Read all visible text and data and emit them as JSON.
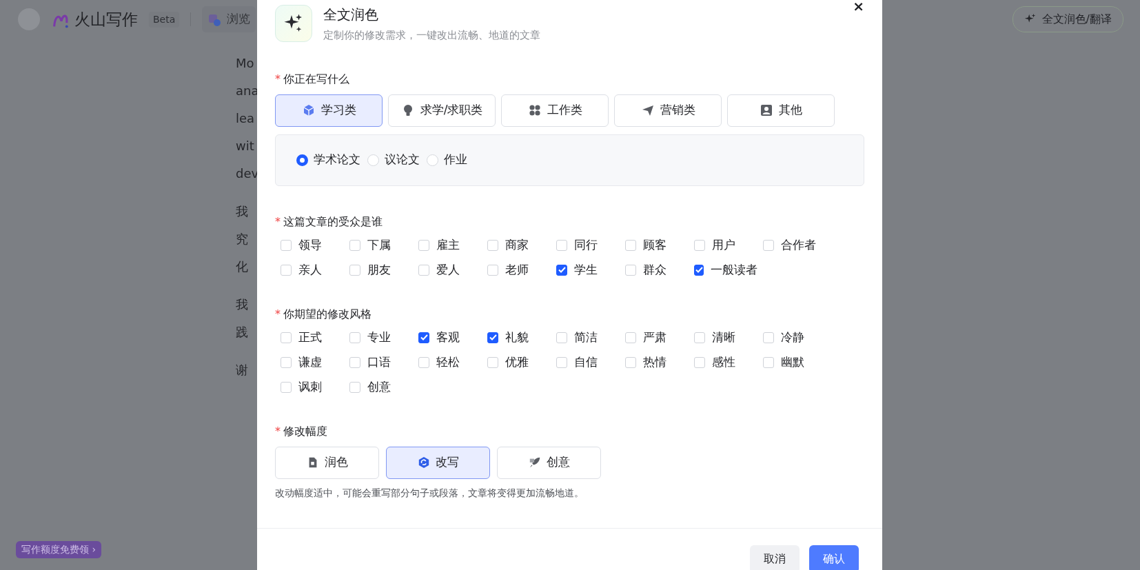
{
  "app": {
    "brand": "火山写作",
    "badge": "Beta",
    "tab_partial": "浏览",
    "action": "全文润色/翻译",
    "promo": "写作额度免费领",
    "promo_arrow": "›"
  },
  "article": {
    "paragraphs": [
      [
        {
          "start": "Mo"
        },
        {
          "start": "ana"
        },
        {
          "start": "lea"
        },
        {
          "start": "wit"
        },
        {
          "start": "dev"
        }
      ],
      [
        {
          "start": "我"
        },
        {
          "start": "究"
        },
        {
          "start": "化"
        }
      ],
      [
        {
          "start": "我"
        },
        {
          "start": "践"
        }
      ],
      [
        {
          "start": "谢"
        }
      ]
    ]
  },
  "dialog": {
    "title": "全文润色",
    "subtitle": "定制你的修改需求，一键改出流畅、地道的文章",
    "close": "×",
    "sections": [
      {
        "kind": "categories",
        "marker": "*",
        "label": "你正在写什么",
        "options": [
          {
            "label": "学习类",
            "selected": true
          },
          {
            "label": "求学/求职类",
            "selected": false
          },
          {
            "label": "工作类",
            "selected": false
          },
          {
            "label": "营销类",
            "selected": false
          },
          {
            "label": "其他",
            "selected": false
          }
        ],
        "sub_options": [
          {
            "label": "学术论文",
            "selected": true
          },
          {
            "label": "议论文",
            "selected": false
          },
          {
            "label": "作业",
            "selected": false
          }
        ]
      },
      {
        "kind": "checkboxes",
        "marker": "*",
        "label": "这篇文章的受众是谁",
        "options": [
          {
            "label": "领导",
            "checked": false
          },
          {
            "label": "下属",
            "checked": false
          },
          {
            "label": "雇主",
            "checked": false
          },
          {
            "label": "商家",
            "checked": false
          },
          {
            "label": "同行",
            "checked": false
          },
          {
            "label": "顾客",
            "checked": false
          },
          {
            "label": "用户",
            "checked": false
          },
          {
            "label": "合作者",
            "checked": false
          },
          {
            "label": "亲人",
            "checked": false
          },
          {
            "label": "朋友",
            "checked": false
          },
          {
            "label": "爱人",
            "checked": false
          },
          {
            "label": "老师",
            "checked": false
          },
          {
            "label": "学生",
            "checked": true
          },
          {
            "label": "群众",
            "checked": false
          },
          {
            "label": "一般读者",
            "checked": true
          }
        ]
      },
      {
        "kind": "checkboxes",
        "marker": "*",
        "label": "你期望的修改风格",
        "options": [
          {
            "label": "正式",
            "checked": false
          },
          {
            "label": "专业",
            "checked": false
          },
          {
            "label": "客观",
            "checked": true
          },
          {
            "label": "礼貌",
            "checked": true
          },
          {
            "label": "简洁",
            "checked": false
          },
          {
            "label": "严肃",
            "checked": false
          },
          {
            "label": "清晰",
            "checked": false
          },
          {
            "label": "冷静",
            "checked": false
          },
          {
            "label": "谦虚",
            "checked": false
          },
          {
            "label": "口语",
            "checked": false
          },
          {
            "label": "轻松",
            "checked": false
          },
          {
            "label": "优雅",
            "checked": false
          },
          {
            "label": "自信",
            "checked": false
          },
          {
            "label": "热情",
            "checked": false
          },
          {
            "label": "感性",
            "checked": false
          },
          {
            "label": "幽默",
            "checked": false
          },
          {
            "label": "讽刺",
            "checked": false
          },
          {
            "label": "创意",
            "checked": false
          }
        ]
      },
      {
        "kind": "range",
        "marker": "*",
        "label": "修改幅度",
        "options": [
          {
            "label": "润色",
            "selected": false
          },
          {
            "label": "改写",
            "selected": true
          },
          {
            "label": "创意",
            "selected": false
          }
        ],
        "hint": "改动幅度适中，可能会重写部分句子或段落，文章将变得更加流畅地道。"
      }
    ],
    "buttons": [
      {
        "label": "取消",
        "kind": "secondary"
      },
      {
        "label": "确认",
        "kind": "primary"
      }
    ]
  }
}
